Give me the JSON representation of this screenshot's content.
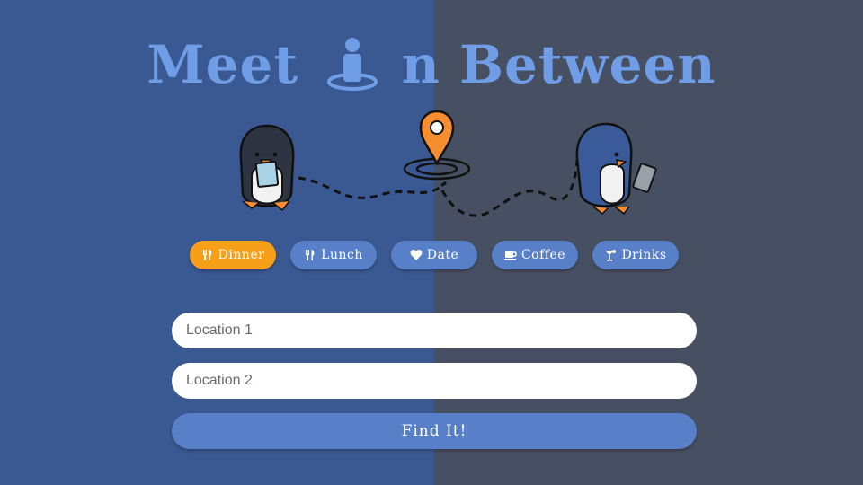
{
  "header": {
    "title_part1": "Meet",
    "title_part2": "n Between",
    "title_icon": "person-on-pin-icon"
  },
  "colors": {
    "left_bg": "#3a5891",
    "right_bg": "#474f63",
    "accent": "#6f9de6",
    "active_tab": "#f6a01a",
    "tab": "#5880c8",
    "pin": "#f68d2e"
  },
  "illustration": {
    "left_character": "penguin-with-map",
    "center": "location-pin-icon",
    "right_character": "penguin-with-phone"
  },
  "tabs": [
    {
      "label": "Dinner",
      "icon": "utensils-icon",
      "active": true
    },
    {
      "label": "Lunch",
      "icon": "utensils-icon",
      "active": false
    },
    {
      "label": "Date",
      "icon": "heart-icon",
      "active": false
    },
    {
      "label": "Coffee",
      "icon": "coffee-icon",
      "active": false
    },
    {
      "label": "Drinks",
      "icon": "cocktail-icon",
      "active": false
    }
  ],
  "form": {
    "location1_placeholder": "Location 1",
    "location2_placeholder": "Location 2",
    "submit_label": "Find It!"
  }
}
